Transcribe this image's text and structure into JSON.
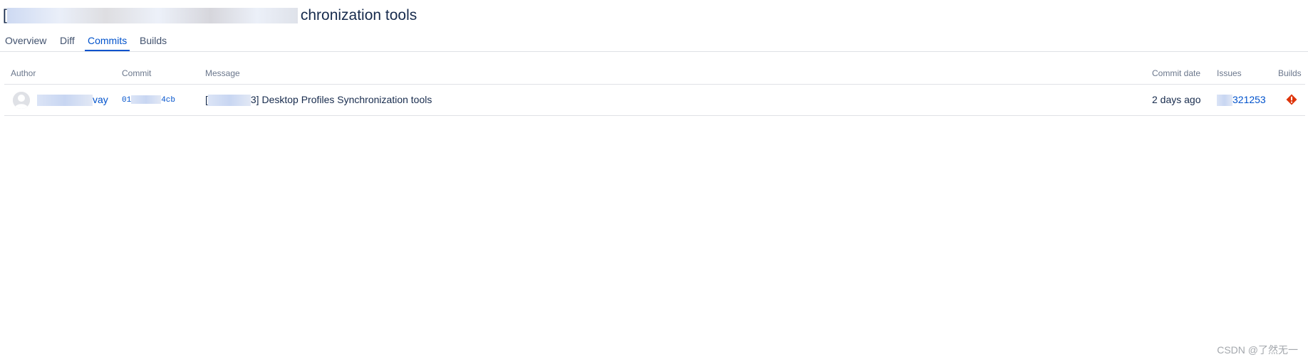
{
  "pull_request": {
    "title_prefix": "[",
    "title_suffix": "chronization tools"
  },
  "tabs": [
    {
      "label": "Overview",
      "active": false
    },
    {
      "label": "Diff",
      "active": false
    },
    {
      "label": "Commits",
      "active": true
    },
    {
      "label": "Builds",
      "active": false
    }
  ],
  "commits_table": {
    "columns": {
      "author": "Author",
      "commit": "Commit",
      "message": "Message",
      "commit_date": "Commit date",
      "issues": "Issues",
      "builds": "Builds"
    },
    "rows": [
      {
        "author_suffix": "vay",
        "commit_prefix": "01",
        "commit_suffix": "4cb",
        "message_prefix": "[",
        "message_suffix": "3] Desktop Profiles Synchronization tools",
        "commit_date": "2 days ago",
        "issue_suffix": "321253",
        "build_status": "failed",
        "build_status_color": "#de350b"
      }
    ]
  },
  "colors": {
    "link": "#0052cc",
    "text": "#172b4d",
    "muted": "#6b778c",
    "divider": "#dfe1e6"
  },
  "watermark": "CSDN @了然无一"
}
